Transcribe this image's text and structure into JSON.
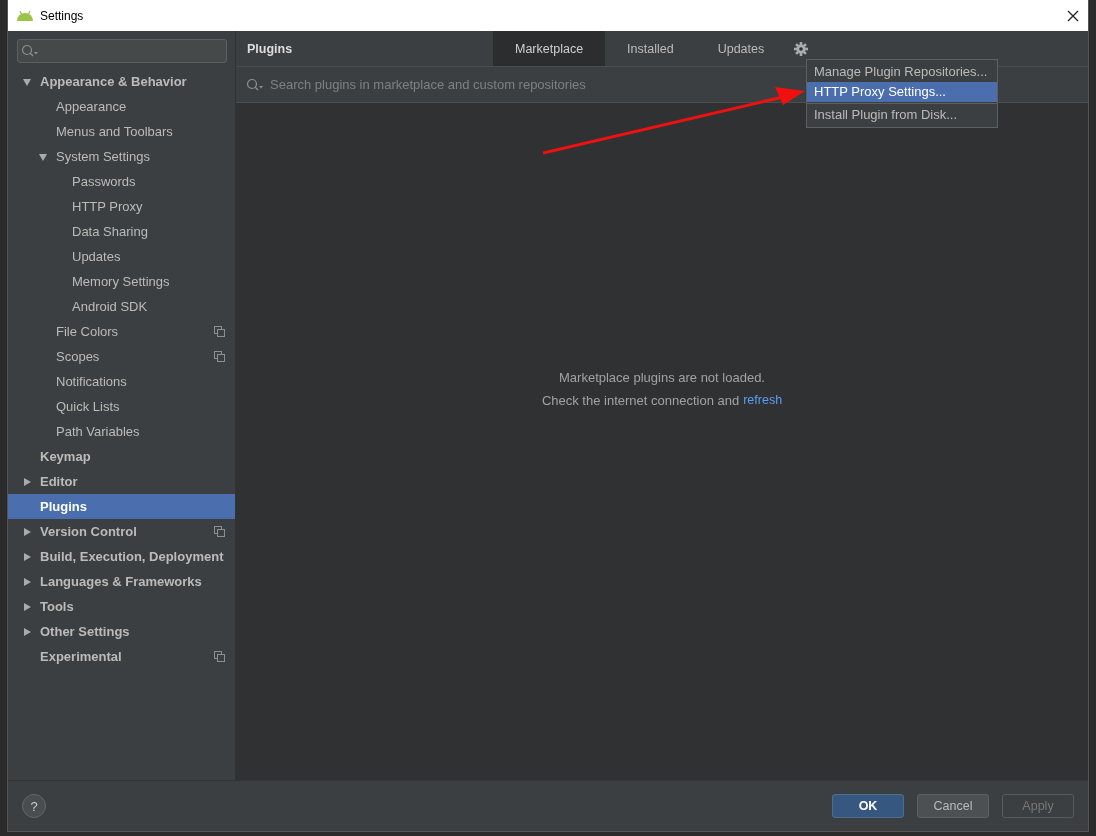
{
  "window": {
    "title": "Settings"
  },
  "sidebar": {
    "items": [
      {
        "label": "Appearance & Behavior",
        "bold": true,
        "expanded": true,
        "selected": false,
        "shared": false,
        "children": [
          {
            "label": "Appearance",
            "bold": false,
            "selected": false,
            "shared": false
          },
          {
            "label": "Menus and Toolbars",
            "bold": false,
            "selected": false,
            "shared": false
          },
          {
            "label": "System Settings",
            "bold": false,
            "expanded": true,
            "selected": false,
            "shared": false,
            "children": [
              {
                "label": "Passwords",
                "bold": false,
                "selected": false,
                "shared": false
              },
              {
                "label": "HTTP Proxy",
                "bold": false,
                "selected": false,
                "shared": false
              },
              {
                "label": "Data Sharing",
                "bold": false,
                "selected": false,
                "shared": false
              },
              {
                "label": "Updates",
                "bold": false,
                "selected": false,
                "shared": false
              },
              {
                "label": "Memory Settings",
                "bold": false,
                "selected": false,
                "shared": false
              },
              {
                "label": "Android SDK",
                "bold": false,
                "selected": false,
                "shared": false
              }
            ]
          },
          {
            "label": "File Colors",
            "bold": false,
            "selected": false,
            "shared": true
          },
          {
            "label": "Scopes",
            "bold": false,
            "selected": false,
            "shared": true
          },
          {
            "label": "Notifications",
            "bold": false,
            "selected": false,
            "shared": false
          },
          {
            "label": "Quick Lists",
            "bold": false,
            "selected": false,
            "shared": false
          },
          {
            "label": "Path Variables",
            "bold": false,
            "selected": false,
            "shared": false
          }
        ]
      },
      {
        "label": "Keymap",
        "bold": true,
        "selected": false,
        "shared": false
      },
      {
        "label": "Editor",
        "bold": true,
        "expanded": false,
        "selected": false,
        "shared": false
      },
      {
        "label": "Plugins",
        "bold": true,
        "selected": true,
        "shared": false
      },
      {
        "label": "Version Control",
        "bold": true,
        "expanded": false,
        "selected": false,
        "shared": true
      },
      {
        "label": "Build, Execution, Deployment",
        "bold": true,
        "expanded": false,
        "selected": false,
        "shared": false
      },
      {
        "label": "Languages & Frameworks",
        "bold": true,
        "expanded": false,
        "selected": false,
        "shared": false
      },
      {
        "label": "Tools",
        "bold": true,
        "expanded": false,
        "selected": false,
        "shared": false
      },
      {
        "label": "Other Settings",
        "bold": true,
        "expanded": false,
        "selected": false,
        "shared": false
      },
      {
        "label": "Experimental",
        "bold": true,
        "selected": false,
        "shared": true
      }
    ]
  },
  "content": {
    "title": "Plugins",
    "tabs": [
      {
        "label": "Marketplace",
        "selected": true
      },
      {
        "label": "Installed",
        "selected": false
      },
      {
        "label": "Updates",
        "selected": false
      }
    ],
    "search": {
      "placeholder": "Search plugins in marketplace and custom repositories"
    },
    "message": "Marketplace plugins are not loaded.",
    "hint": "Check the internet connection and",
    "link": "refresh",
    "menu": [
      {
        "label": "Manage Plugin Repositories...",
        "selected": false,
        "separator_after": false
      },
      {
        "label": "HTTP Proxy Settings...",
        "selected": true,
        "separator_after": true
      },
      {
        "label": "Install Plugin from Disk...",
        "selected": false,
        "separator_after": false
      }
    ]
  },
  "footer": {
    "help": "?",
    "buttons": [
      {
        "label": "OK",
        "kind": "default",
        "disabled": false
      },
      {
        "label": "Cancel",
        "kind": "normal",
        "disabled": false
      },
      {
        "label": "Apply",
        "kind": "normal",
        "disabled": true
      }
    ]
  }
}
